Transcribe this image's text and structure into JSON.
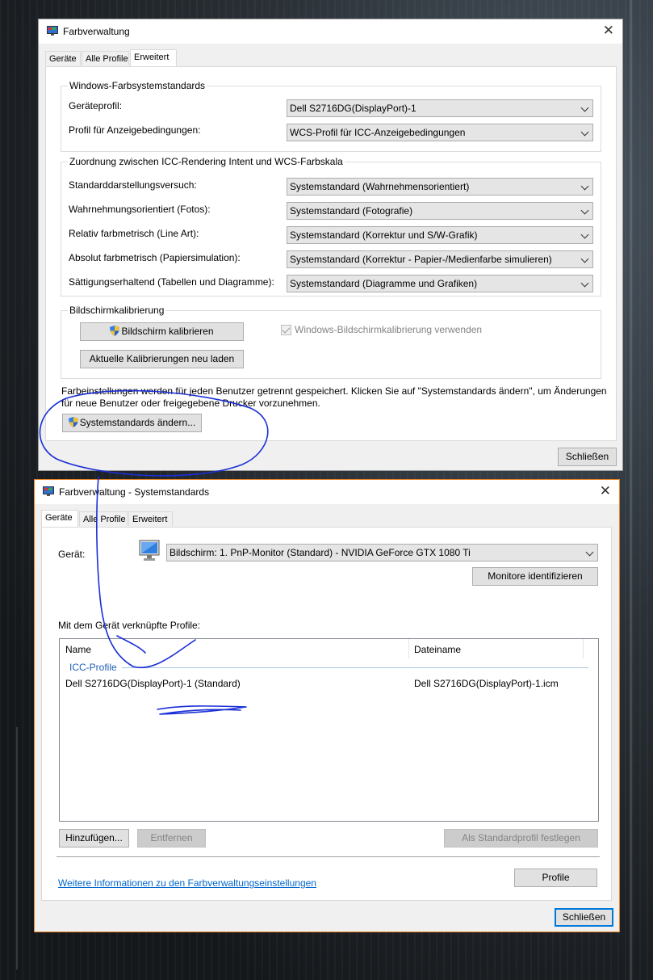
{
  "top_window": {
    "title": "Farbverwaltung",
    "tabs": [
      "Geräte",
      "Alle Profile",
      "Erweitert"
    ],
    "group1": {
      "legend": "Windows-Farbsystemstandards",
      "rows": [
        {
          "label": "Geräteprofil:",
          "value": "Dell S2716DG(DisplayPort)-1"
        },
        {
          "label": "Profil für Anzeigebedingungen:",
          "value": "WCS-Profil für ICC-Anzeigebedingungen"
        }
      ]
    },
    "group2": {
      "legend": "Zuordnung zwischen ICC-Rendering Intent und WCS-Farbskala",
      "rows": [
        {
          "label": "Standarddarstellungsversuch:",
          "value": "Systemstandard (Wahrnehmensorientiert)"
        },
        {
          "label": "Wahrnehmungsorientiert (Fotos):",
          "value": "Systemstandard (Fotografie)"
        },
        {
          "label": "Relativ farbmetrisch (Line Art):",
          "value": "Systemstandard (Korrektur und S/W-Grafik)"
        },
        {
          "label": "Absolut farbmetrisch (Papiersimulation):",
          "value": "Systemstandard (Korrektur - Papier-/Medienfarbe simulieren)"
        },
        {
          "label": "Sättigungserhaltend (Tabellen und Diagramme):",
          "value": "Systemstandard (Diagramme und Grafiken)"
        }
      ]
    },
    "group3": {
      "legend": "Bildschirmkalibrierung",
      "calibrate_button": "Bildschirm kalibrieren",
      "reload_button": "Aktuelle Kalibrierungen neu laden",
      "checkbox_label": "Windows-Bildschirmkalibrierung verwenden"
    },
    "info_line1": "Farbeinstellungen werden für jeden Benutzer getrennt gespeichert. Klicken Sie auf \"Systemstandards ändern\", um Änderungen",
    "info_line2": "für neue Benutzer oder freigegebene Drucker vorzunehmen.",
    "change_defaults_button": "Systemstandards ändern...",
    "close_button": "Schließen"
  },
  "bottom_window": {
    "title": "Farbverwaltung - Systemstandards",
    "tabs": [
      "Geräte",
      "Alle Profile",
      "Erweitert"
    ],
    "device_label": "Gerät:",
    "device_value": "Bildschirm: 1. PnP-Monitor (Standard) - NVIDIA GeForce GTX 1080 Ti",
    "identify_button": "Monitore identifizieren",
    "profiles_heading": "Mit dem Gerät verknüpfte Profile:",
    "columns": {
      "name": "Name",
      "file": "Dateiname"
    },
    "group_label": "ICC-Profile",
    "rows": [
      {
        "name": "Dell S2716DG(DisplayPort)-1 (Standard)",
        "file": "Dell S2716DG(DisplayPort)-1.icm"
      }
    ],
    "add_button": "Hinzufügen...",
    "remove_button": "Entfernen",
    "set_default_button": "Als Standardprofil festlegen",
    "more_info_link": "Weitere Informationen zu den Farbverwaltungseinstellungen",
    "profiles_button": "Profile",
    "close_button": "Schließen"
  },
  "colors": {
    "accent": "#0078d7",
    "annotation_ink": "#1a2fd6",
    "link": "#0066cc"
  }
}
